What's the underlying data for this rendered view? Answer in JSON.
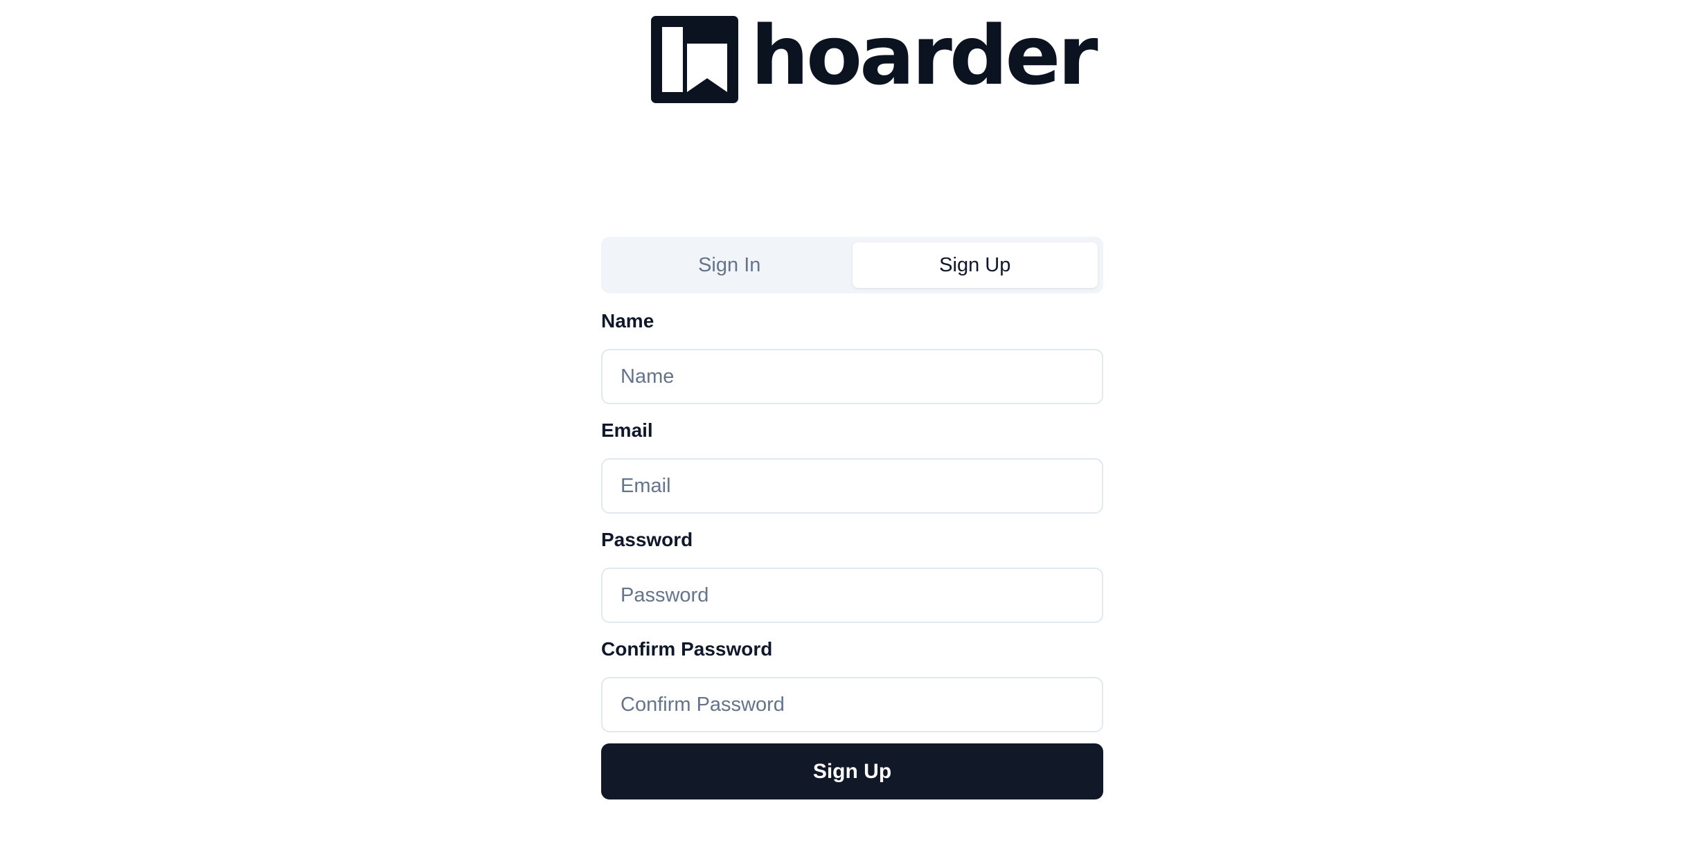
{
  "brand": {
    "name": "hoarder",
    "logo_icon": "bookmark-book-icon",
    "color": "#0b1220"
  },
  "auth": {
    "tabs": [
      {
        "label": "Sign In",
        "active": false
      },
      {
        "label": "Sign Up",
        "active": true
      }
    ],
    "fields": {
      "name": {
        "label": "Name",
        "placeholder": "Name",
        "value": ""
      },
      "email": {
        "label": "Email",
        "placeholder": "Email",
        "value": ""
      },
      "password": {
        "label": "Password",
        "placeholder": "Password",
        "value": ""
      },
      "confirm_password": {
        "label": "Confirm Password",
        "placeholder": "Confirm Password",
        "value": ""
      }
    },
    "submit_label": "Sign Up"
  },
  "colors": {
    "primary_button": "#111827",
    "tab_track": "#f1f5f9",
    "muted_text": "#64748b",
    "input_border": "#e2e8f0"
  }
}
